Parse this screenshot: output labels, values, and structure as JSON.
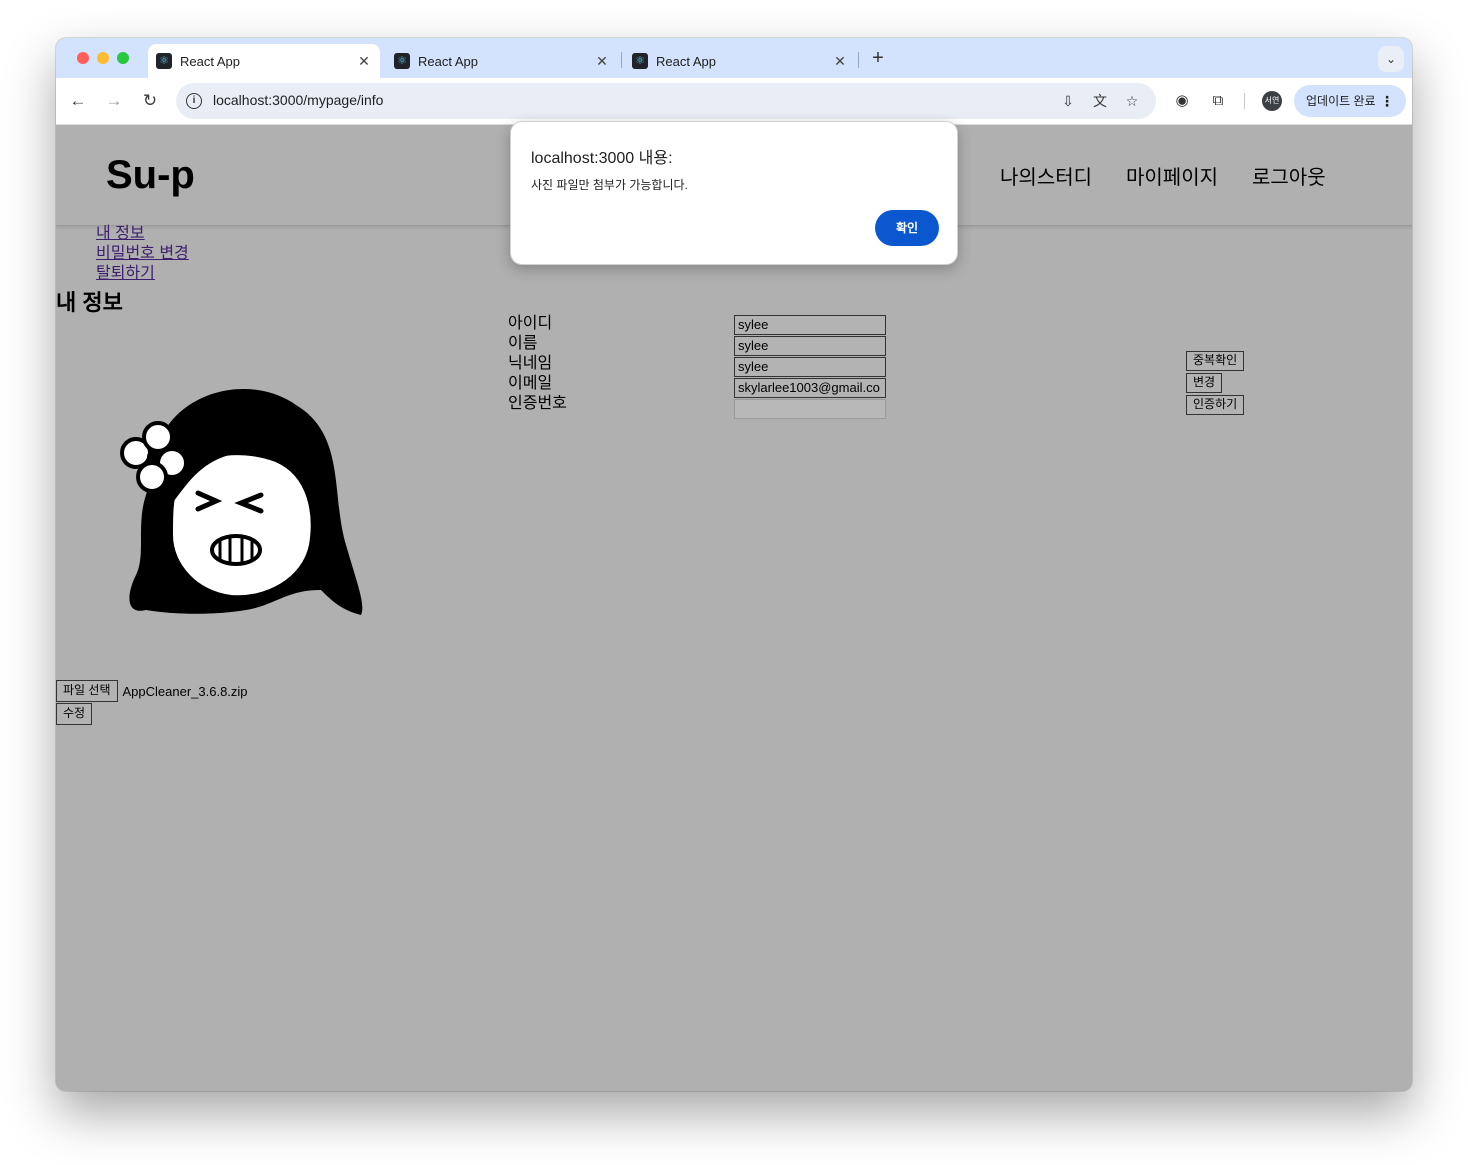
{
  "browser": {
    "tabs": [
      {
        "title": "React App",
        "active": true
      },
      {
        "title": "React App",
        "active": false
      },
      {
        "title": "React App",
        "active": false
      }
    ],
    "url": "localhost:3000/mypage/info",
    "profile_initials": "서연",
    "update_button_label": "업데이트 완료"
  },
  "site": {
    "logo": "Su-p",
    "nav": [
      "나의스터디",
      "마이페이지",
      "로그아웃"
    ]
  },
  "sidebar": {
    "links": [
      "내 정보",
      "비밀번호 변경",
      "탈퇴하기"
    ]
  },
  "main": {
    "title": "내 정보",
    "fields": [
      {
        "label": "아이디",
        "value": "sylee"
      },
      {
        "label": "이름",
        "value": "sylee"
      },
      {
        "label": "닉네임",
        "value": "sylee"
      },
      {
        "label": "이메일",
        "value": "skylarlee1003@gmail.co"
      },
      {
        "label": "인증번호",
        "value": ""
      }
    ],
    "buttons": {
      "check_duplicate": "중복확인",
      "change": "변경",
      "verify": "인증하기"
    },
    "file": {
      "choose_label": "파일 선택",
      "file_name": "AppCleaner_3.6.8.zip"
    },
    "edit_label": "수정"
  },
  "alert": {
    "title": "localhost:3000 내용:",
    "message": "사진 파일만 첨부가 가능합니다.",
    "ok_label": "확인"
  },
  "colors": {
    "tab_strip": "#d3e3fd",
    "page_overlay": "#b0b0b0",
    "alert_button": "#0b57d0"
  }
}
